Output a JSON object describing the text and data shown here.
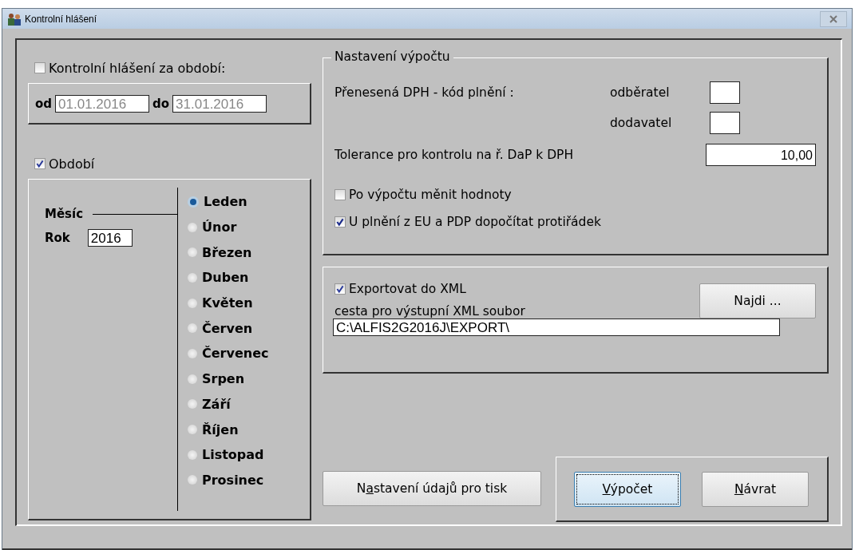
{
  "window": {
    "title": "Kontrolní hlášení"
  },
  "period_range": {
    "checkbox": {
      "label": "Kontrolní hlášení za období:",
      "checked": false
    },
    "from_label": "od",
    "from": "01.01.2016",
    "to_label": "do",
    "to": "31.01.2016"
  },
  "period": {
    "checkbox": {
      "label": "Období",
      "checked": true
    },
    "month_label": "Měsíc",
    "year_label": "Rok",
    "year": "2016",
    "months": [
      {
        "label": "Leden",
        "selected": true
      },
      {
        "label": "Únor",
        "selected": false
      },
      {
        "label": "Březen",
        "selected": false
      },
      {
        "label": "Duben",
        "selected": false
      },
      {
        "label": "Květen",
        "selected": false
      },
      {
        "label": "Červen",
        "selected": false
      },
      {
        "label": "Červenec",
        "selected": false
      },
      {
        "label": "Srpen",
        "selected": false
      },
      {
        "label": "Září",
        "selected": false
      },
      {
        "label": "Říjen",
        "selected": false
      },
      {
        "label": "Listopad",
        "selected": false
      },
      {
        "label": "Prosinec",
        "selected": false
      }
    ]
  },
  "calculation": {
    "title": "Nastavení výpočtu",
    "transfer_label": "Přenesená DPH - kód plnění :",
    "customer_label": "odběratel",
    "supplier_label": "dodavatel",
    "tolerance_label": "Tolerance pro kontrolu na ř. DaP k DPH",
    "tolerance": "10,00",
    "options": [
      {
        "label": "Po výpočtu měnit hodnoty",
        "checked": false
      },
      {
        "label": "U plnění z EU a PDP dopočítat protiřádek",
        "checked": true
      }
    ]
  },
  "export": {
    "checkbox": {
      "label": "Exportovat do XML",
      "checked": true
    },
    "find_button": "Najdi ...",
    "path_label": "cesta pro výstupní XML soubor",
    "path": "C:\\ALFIS2G2016J\\EXPORT\\"
  },
  "buttons": [
    {
      "pre": "N",
      "key": "a",
      "post": "stavení údajů pro tisk",
      "focused": false
    },
    {
      "key": "V",
      "post": "ýpočet",
      "focused": true
    },
    {
      "key": "N",
      "post": "ávrat",
      "focused": false
    }
  ]
}
